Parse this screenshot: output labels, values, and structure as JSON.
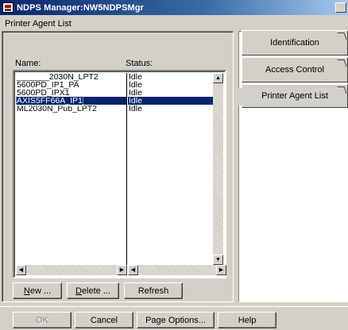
{
  "window": {
    "title": "NDPS Manager:NW5NDPSMgr"
  },
  "group_label": "Printer Agent List",
  "list": {
    "headers": {
      "name": "Name:",
      "status": "Status:"
    },
    "rows": [
      {
        "name": "_______2030N_LPT2",
        "status": "Idle",
        "selected": false
      },
      {
        "name": "5600PD_IP1_PA",
        "status": "Idle",
        "selected": false
      },
      {
        "name": "5600PD_IPX1",
        "status": "Idle",
        "selected": false
      },
      {
        "name": "AXIS5FF66A_IP1",
        "status": "Idle",
        "selected": true
      },
      {
        "name": "ML2030N_Pub_LPT2",
        "status": "Idle",
        "selected": false
      }
    ]
  },
  "buttons": {
    "new_ul": "N",
    "new_rest": "ew ...",
    "delete_ul": "D",
    "delete_rest": "elete ...",
    "refresh": "Refresh"
  },
  "tabs": {
    "identification": "Identification",
    "access_control": "Access Control",
    "printer_agent_list": "Printer Agent List"
  },
  "footer": {
    "ok": "OK",
    "cancel": "Cancel",
    "page_options": "Page Options...",
    "help": "Help"
  }
}
